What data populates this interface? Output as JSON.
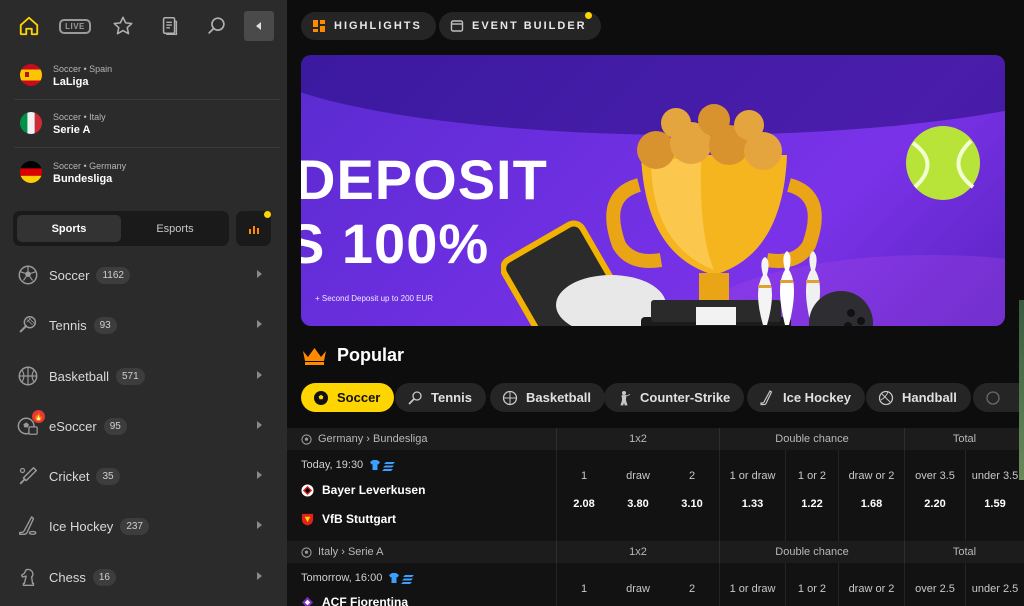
{
  "nav": {
    "icons": [
      "home-icon",
      "live-icon",
      "star-icon",
      "betslip-icon",
      "search-icon"
    ],
    "live_label": "LIVE",
    "collapse": "collapse-icon"
  },
  "leagues": [
    {
      "path": "Soccer • Spain",
      "name": "LaLiga",
      "flag": "spain"
    },
    {
      "path": "Soccer • Italy",
      "name": "Serie A",
      "flag": "italy"
    },
    {
      "path": "Soccer • Germany",
      "name": "Bundesliga",
      "flag": "germany"
    }
  ],
  "segment": {
    "active": "Sports",
    "inactive": "Esports"
  },
  "sports": [
    {
      "name": "Soccer",
      "count": "1162",
      "icon": "soccer-ball-icon"
    },
    {
      "name": "Tennis",
      "count": "93",
      "icon": "tennis-racket-icon"
    },
    {
      "name": "Basketball",
      "count": "571",
      "icon": "basketball-icon"
    },
    {
      "name": "eSoccer",
      "count": "95",
      "icon": "esoccer-icon"
    },
    {
      "name": "Cricket",
      "count": "35",
      "icon": "cricket-bat-icon"
    },
    {
      "name": "Ice Hockey",
      "count": "237",
      "icon": "hockey-stick-icon"
    },
    {
      "name": "Chess",
      "count": "16",
      "icon": "chess-knight-icon"
    }
  ],
  "top_tabs": {
    "highlights": "HIGHLIGHTS",
    "event_builder": "EVENT BUILDER"
  },
  "banner": {
    "line1": "DEPOSIT",
    "line2": "S 100%",
    "note": "+ Second Deposit up to 200 EUR"
  },
  "popular": {
    "title": "Popular"
  },
  "chips": [
    "Soccer",
    "Tennis",
    "Basketball",
    "Counter-Strike",
    "Ice Hockey",
    "Handball"
  ],
  "markets": {
    "onex2": "1x2",
    "double_chance": "Double chance",
    "total": "Total"
  },
  "events": [
    {
      "league": "Germany › Bundesliga",
      "time": "Today, 19:30",
      "home": "Bayer Leverkusen",
      "away": "VfB Stuttgart",
      "labels": [
        "1",
        "draw",
        "2",
        "1 or draw",
        "1 or 2",
        "draw or 2",
        "over 3.5",
        "under 3.5"
      ],
      "odds": [
        "2.08",
        "3.80",
        "3.10",
        "1.33",
        "1.22",
        "1.68",
        "2.20",
        "1.59"
      ]
    },
    {
      "league": "Italy › Serie A",
      "time": "Tomorrow, 16:00",
      "home": "ACF Fiorentina",
      "labels": [
        "1",
        "draw",
        "2",
        "1 or draw",
        "1 or 2",
        "draw or 2",
        "over 2.5",
        "under 2.5"
      ]
    }
  ],
  "colors": {
    "accent": "#ffd500",
    "sidebar": "#2b2b2b",
    "banner": "#6d2fe0"
  }
}
